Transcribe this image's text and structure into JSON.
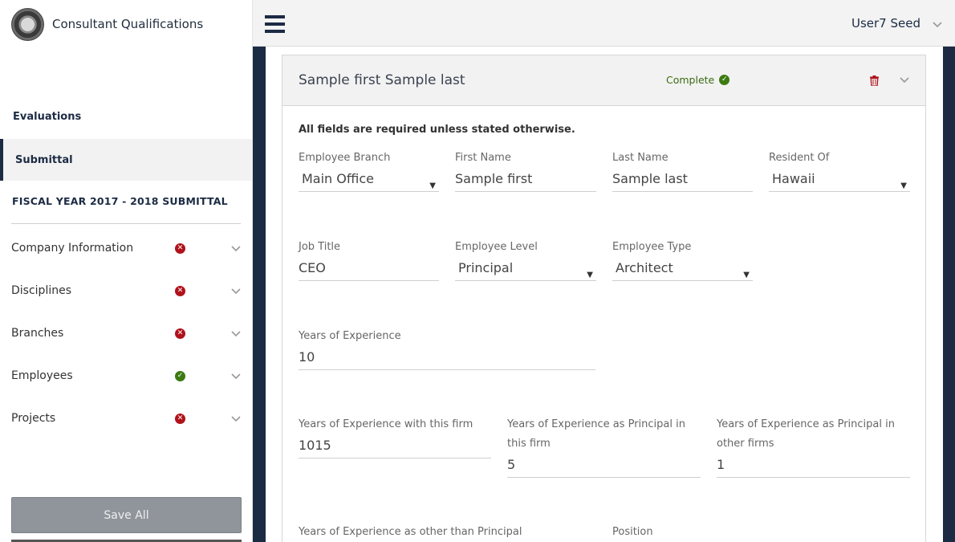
{
  "app": {
    "title": "Consultant Qualifications"
  },
  "nav": {
    "evaluations": "Evaluations",
    "submittal": "Submittal",
    "fiscal_year": "FISCAL YEAR 2017 - 2018 SUBMITTAL",
    "sections": [
      {
        "label": "Company Information",
        "status": "error"
      },
      {
        "label": "Disciplines",
        "status": "error"
      },
      {
        "label": "Branches",
        "status": "error"
      },
      {
        "label": "Employees",
        "status": "complete"
      },
      {
        "label": "Projects",
        "status": "error"
      }
    ],
    "save_all": "Save All"
  },
  "header": {
    "user": "User7 Seed"
  },
  "employee": {
    "name": "Sample first Sample last",
    "status": "Complete",
    "required_note": "All fields are required unless stated otherwise.",
    "fields": {
      "branch": {
        "label": "Employee Branch",
        "value": "Main Office"
      },
      "first_name": {
        "label": "First Name",
        "value": "Sample first"
      },
      "last_name": {
        "label": "Last Name",
        "value": "Sample last"
      },
      "resident_of": {
        "label": "Resident Of",
        "value": "Hawaii"
      },
      "job_title": {
        "label": "Job Title",
        "value": "CEO"
      },
      "employee_level": {
        "label": "Employee Level",
        "value": "Principal"
      },
      "employee_type": {
        "label": "Employee Type",
        "value": "Architect"
      },
      "years_exp": {
        "label": "Years of Experience",
        "value": "10"
      },
      "years_firm": {
        "label": "Years of Experience with this firm",
        "value": "1015"
      },
      "years_principal_this": {
        "label": "Years of Experience as Principal in this firm",
        "value": "5"
      },
      "years_principal_other": {
        "label": "Years of Experience as Principal in other firms",
        "value": "1"
      },
      "years_other_than_principal": {
        "label": "Years of Experience as other than Principal"
      },
      "position": {
        "label": "Position"
      }
    }
  },
  "colors": {
    "navy": "#1c2b44",
    "error": "#b0121b",
    "success": "#3c7a12"
  }
}
